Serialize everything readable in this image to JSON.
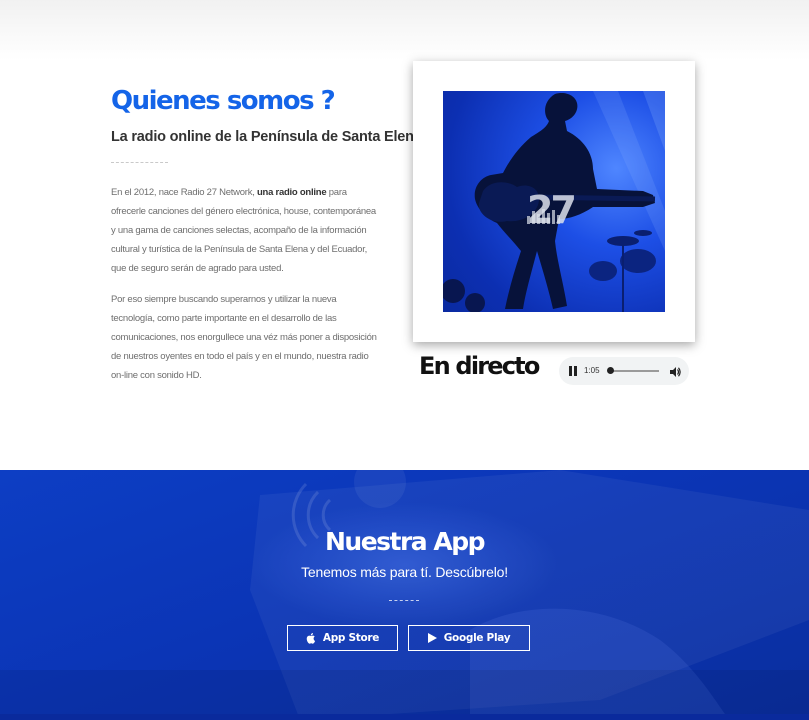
{
  "about": {
    "title": "Quienes somos ?",
    "subtitle": "La radio online de la Península de Santa Elena",
    "paragraph1_start": "En el 2012, nace Radio 27 Network, ",
    "paragraph1_bold": "una radio online",
    "paragraph1_end": " para ofrecerle canciones del género electrónica, house, contemporánea y una gama de canciones selectas, acompaño de la información cultural y turística de la Península de Santa Elena y del Ecuador, que de seguro serán de agrado para usted.",
    "paragraph2": "Por eso siempre buscando superarnos y utilizar la nueva tecnología, como parte importante en el desarrollo de las comunicaciones, nos enorgullece una véz más poner a disposición de nuestros oyentes en todo el país y en el mundo, nuestra radio on-line con sonido HD."
  },
  "photo": {
    "logo_text": "27",
    "tint_color": "#1d4fe6"
  },
  "live": {
    "label": "En directo",
    "player": {
      "state": "playing",
      "time": "1:05",
      "progress": 0.05,
      "pause_icon": "pause-icon",
      "volume_icon": "volume-icon"
    }
  },
  "app": {
    "title": "Nuestra App",
    "subtitle": "Tenemos más para tí. Descúbrelo!",
    "buttons": [
      {
        "label": "App Store",
        "icon": "apple-icon"
      },
      {
        "label": "Google Play",
        "icon": "play-icon"
      }
    ]
  },
  "colors": {
    "accent": "#1464e8",
    "app_background": "#0b35b6"
  }
}
